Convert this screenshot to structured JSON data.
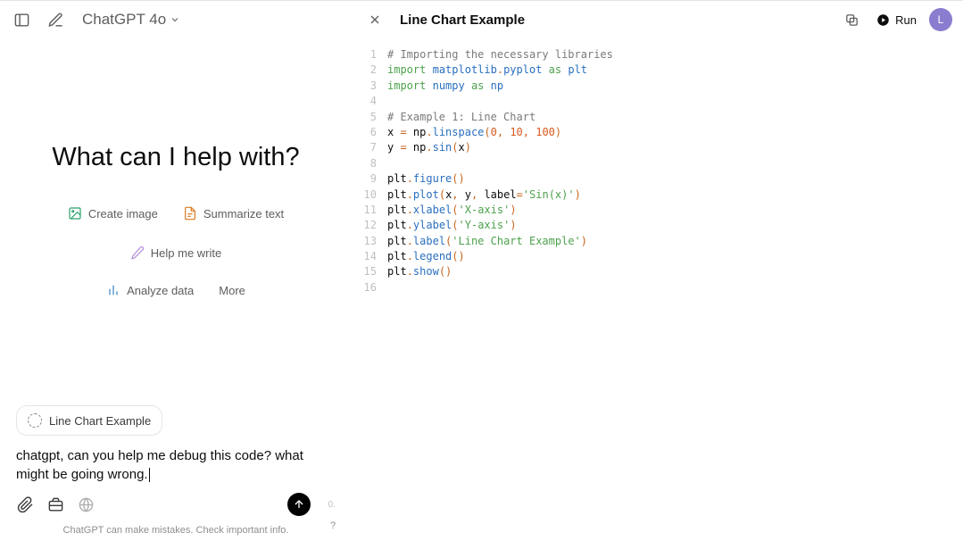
{
  "header": {
    "model": "ChatGPT 4o"
  },
  "chat": {
    "heading": "What can I help with?",
    "suggestions": {
      "create_image": "Create image",
      "summarize": "Summarize text",
      "help_write": "Help me write",
      "analyze": "Analyze data",
      "more": "More"
    }
  },
  "composer": {
    "chip_label": "Line Chart Example",
    "text": "chatgpt, can you help me debug this code? what might be going wrong.",
    "side": "0.",
    "disclaimer": "ChatGPT can make mistakes. Check important info.",
    "help": "?"
  },
  "code": {
    "title": "Line Chart Example",
    "run": "Run",
    "avatar": "L",
    "lines": [
      {
        "n": 1,
        "t": [
          [
            "cm",
            "# Importing the necessary libraries"
          ]
        ]
      },
      {
        "n": 2,
        "t": [
          [
            "kw",
            "import"
          ],
          [
            "id",
            " "
          ],
          [
            "md",
            "matplotlib"
          ],
          [
            "op",
            "."
          ],
          [
            "at",
            "pyplot"
          ],
          [
            "id",
            " "
          ],
          [
            "kw",
            "as"
          ],
          [
            "id",
            " "
          ],
          [
            "md",
            "plt"
          ]
        ]
      },
      {
        "n": 3,
        "t": [
          [
            "kw",
            "import"
          ],
          [
            "id",
            " "
          ],
          [
            "md",
            "numpy"
          ],
          [
            "id",
            " "
          ],
          [
            "kw",
            "as"
          ],
          [
            "id",
            " "
          ],
          [
            "md",
            "np"
          ]
        ]
      },
      {
        "n": 4,
        "t": []
      },
      {
        "n": 5,
        "t": [
          [
            "cm",
            "# Example 1: Line Chart"
          ]
        ]
      },
      {
        "n": 6,
        "t": [
          [
            "id",
            "x "
          ],
          [
            "op",
            "="
          ],
          [
            "id",
            " np"
          ],
          [
            "op",
            "."
          ],
          [
            "at",
            "linspace"
          ],
          [
            "op",
            "("
          ],
          [
            "nm",
            "0"
          ],
          [
            "op",
            ", "
          ],
          [
            "nm",
            "10"
          ],
          [
            "op",
            ", "
          ],
          [
            "nm",
            "100"
          ],
          [
            "op",
            ")"
          ]
        ]
      },
      {
        "n": 7,
        "t": [
          [
            "id",
            "y "
          ],
          [
            "op",
            "="
          ],
          [
            "id",
            " np"
          ],
          [
            "op",
            "."
          ],
          [
            "at",
            "sin"
          ],
          [
            "op",
            "("
          ],
          [
            "id",
            "x"
          ],
          [
            "op",
            ")"
          ]
        ]
      },
      {
        "n": 8,
        "t": []
      },
      {
        "n": 9,
        "t": [
          [
            "id",
            "plt"
          ],
          [
            "op",
            "."
          ],
          [
            "at",
            "figure"
          ],
          [
            "op",
            "()"
          ]
        ]
      },
      {
        "n": 10,
        "t": [
          [
            "id",
            "plt"
          ],
          [
            "op",
            "."
          ],
          [
            "at",
            "plot"
          ],
          [
            "op",
            "("
          ],
          [
            "id",
            "x"
          ],
          [
            "op",
            ", "
          ],
          [
            "id",
            "y"
          ],
          [
            "op",
            ", "
          ],
          [
            "id",
            "label"
          ],
          [
            "op",
            "="
          ],
          [
            "st",
            "'Sin(x)'"
          ],
          [
            "op",
            ")"
          ]
        ]
      },
      {
        "n": 11,
        "t": [
          [
            "id",
            "plt"
          ],
          [
            "op",
            "."
          ],
          [
            "at",
            "xlabel"
          ],
          [
            "op",
            "("
          ],
          [
            "st",
            "'X-axis'"
          ],
          [
            "op",
            ")"
          ]
        ]
      },
      {
        "n": 12,
        "t": [
          [
            "id",
            "plt"
          ],
          [
            "op",
            "."
          ],
          [
            "at",
            "ylabel"
          ],
          [
            "op",
            "("
          ],
          [
            "st",
            "'Y-axis'"
          ],
          [
            "op",
            ")"
          ]
        ]
      },
      {
        "n": 13,
        "t": [
          [
            "id",
            "plt"
          ],
          [
            "op",
            "."
          ],
          [
            "at",
            "label"
          ],
          [
            "op",
            "("
          ],
          [
            "st",
            "'Line Chart Example'"
          ],
          [
            "op",
            ")"
          ]
        ]
      },
      {
        "n": 14,
        "t": [
          [
            "id",
            "plt"
          ],
          [
            "op",
            "."
          ],
          [
            "at",
            "legend"
          ],
          [
            "op",
            "()"
          ]
        ]
      },
      {
        "n": 15,
        "t": [
          [
            "id",
            "plt"
          ],
          [
            "op",
            "."
          ],
          [
            "at",
            "show"
          ],
          [
            "op",
            "()"
          ]
        ]
      },
      {
        "n": 16,
        "t": []
      }
    ]
  }
}
